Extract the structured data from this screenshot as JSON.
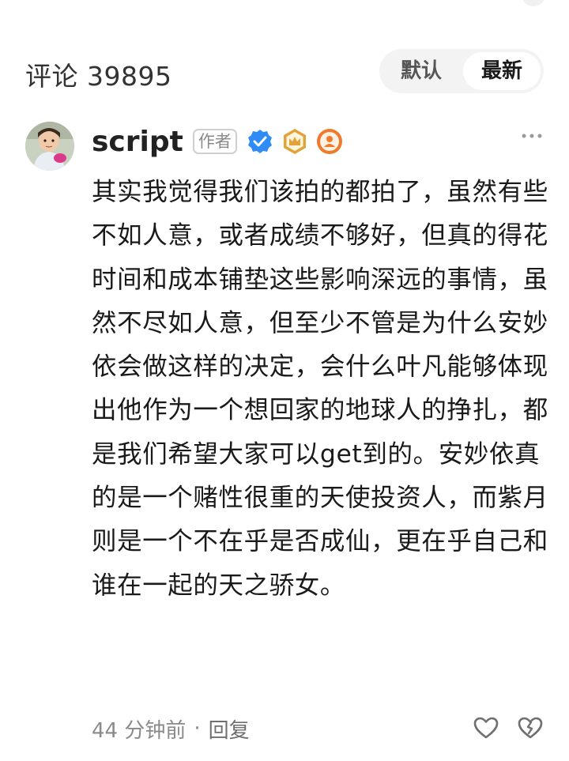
{
  "comments_header": {
    "title": "评论 39895",
    "sort_default_label": "默认",
    "sort_latest_label": "最新",
    "active_sort": "最新"
  },
  "comment": {
    "author_name": "script",
    "author_tag": "作者",
    "badges": [
      "verified-check-icon",
      "crown-badge-icon",
      "profile-badge-icon"
    ],
    "text": "其实我觉得我们该拍的都拍了，虽然有些不如人意，或者成绩不够好，但真的得花时间和成本铺垫这些影响深远的事情，虽然不尽如人意，但至少不管是为什么安妙依会做这样的决定，会什么叶凡能够体现出他作为一个想回家的地球人的挣扎，都是我们希望大家可以get到的。安妙依真的是一个赌性很重的天使投资人，而紫月则是一个不在乎是否成仙，更在乎自己和谁在一起的天之骄女。",
    "time": "44 分钟前",
    "separator": "·",
    "reply_label": "回复"
  },
  "colors": {
    "verified": "#2f8cf5",
    "crown_badge": "#e0a43a",
    "profile_badge": "#f07a2c",
    "muted_text": "#8a8a8a",
    "toggle_bg": "#f3f3f3"
  }
}
